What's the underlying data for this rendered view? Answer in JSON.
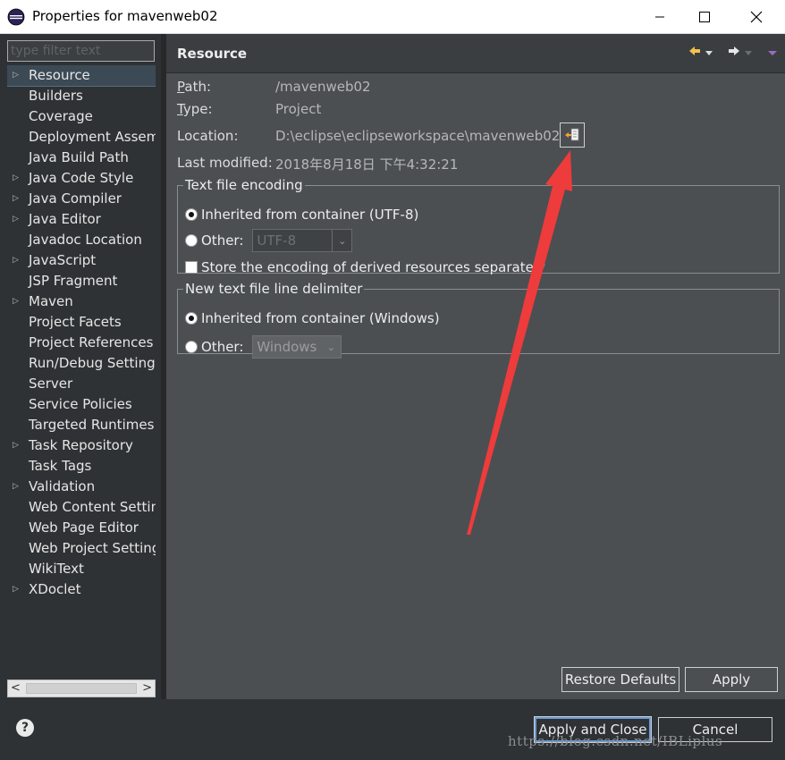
{
  "window": {
    "title": "Properties for mavenweb02",
    "controls": [
      "minimize",
      "maximize",
      "close"
    ]
  },
  "sidebar": {
    "filter_placeholder": "type filter text",
    "items": [
      {
        "label": "Resource",
        "expandable": true,
        "selected": true
      },
      {
        "label": "Builders",
        "expandable": false
      },
      {
        "label": "Coverage",
        "expandable": false
      },
      {
        "label": "Deployment Assem",
        "expandable": false
      },
      {
        "label": "Java Build Path",
        "expandable": false
      },
      {
        "label": "Java Code Style",
        "expandable": true
      },
      {
        "label": "Java Compiler",
        "expandable": true
      },
      {
        "label": "Java Editor",
        "expandable": true
      },
      {
        "label": "Javadoc Location",
        "expandable": false
      },
      {
        "label": "JavaScript",
        "expandable": true
      },
      {
        "label": "JSP Fragment",
        "expandable": false
      },
      {
        "label": "Maven",
        "expandable": true
      },
      {
        "label": "Project Facets",
        "expandable": false
      },
      {
        "label": "Project References",
        "expandable": false
      },
      {
        "label": "Run/Debug Settings",
        "expandable": false
      },
      {
        "label": "Server",
        "expandable": false
      },
      {
        "label": "Service Policies",
        "expandable": false
      },
      {
        "label": "Targeted Runtimes",
        "expandable": false
      },
      {
        "label": "Task Repository",
        "expandable": true
      },
      {
        "label": "Task Tags",
        "expandable": false
      },
      {
        "label": "Validation",
        "expandable": true
      },
      {
        "label": "Web Content Settin",
        "expandable": false
      },
      {
        "label": "Web Page Editor",
        "expandable": false
      },
      {
        "label": "Web Project Setting",
        "expandable": false
      },
      {
        "label": "WikiText",
        "expandable": false
      },
      {
        "label": "XDoclet",
        "expandable": true
      }
    ]
  },
  "content": {
    "title": "Resource",
    "path_label": "Path:",
    "path_value": "/mavenweb02",
    "type_label": "Type:",
    "type_value": "Project",
    "location_label": "Location:",
    "location_value": "D:\\eclipse\\eclipseworkspace\\mavenweb02",
    "modified_label": "Last modified:",
    "modified_value": "2018年8月18日 下午4:32:21",
    "encoding": {
      "legend": "Text file encoding",
      "inherited_label": "Inherited from container (UTF-8)",
      "other_label": "Other:",
      "other_value": "UTF-8",
      "store_label": "Store the encoding of derived resources separately"
    },
    "delimiter": {
      "legend": "New text file line delimiter",
      "inherited_label": "Inherited from container (Windows)",
      "other_label": "Other:",
      "other_value": "Windows"
    },
    "restore_defaults": "Restore Defaults",
    "apply": "Apply"
  },
  "footer": {
    "help": "?",
    "apply_close": "Apply and Close",
    "cancel": "Cancel",
    "watermark": "https://blog.csdn.net/IBLiplus"
  },
  "colors": {
    "background": "#2f3234",
    "content_bg": "#4b4f52",
    "annotation_arrow": "#ee3b3b"
  }
}
